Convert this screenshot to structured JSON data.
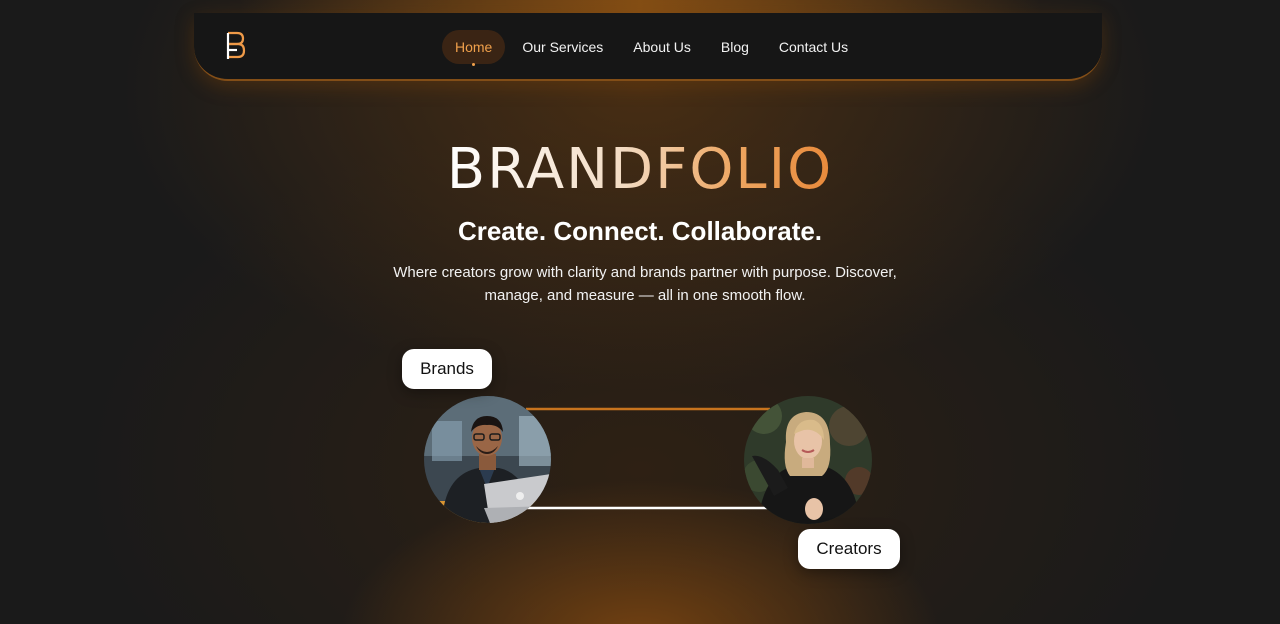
{
  "nav": {
    "logo_icon": "brandfolio-logo-icon",
    "links": [
      {
        "label": "Home",
        "active": true
      },
      {
        "label": "Our Services",
        "active": false
      },
      {
        "label": "About Us",
        "active": false
      },
      {
        "label": "Blog",
        "active": false
      },
      {
        "label": "Contact Us",
        "active": false
      }
    ]
  },
  "hero": {
    "title": "BRANDFOLIO",
    "tagline": "Create. Connect. Collaborate.",
    "description": "Where creators grow with clarity and brands partner with purpose. Discover, manage, and measure — all in one smooth flow."
  },
  "illustration": {
    "brands_label": "Brands",
    "creators_label": "Creators",
    "brand_avatar": "brand-person-with-laptop-photo",
    "creator_avatar": "creator-woman-photo"
  },
  "colors": {
    "accent": "#f0a04b",
    "background": "#1a1a1a",
    "connector_top": "#c8741e",
    "connector_bottom": "#ffffff"
  }
}
